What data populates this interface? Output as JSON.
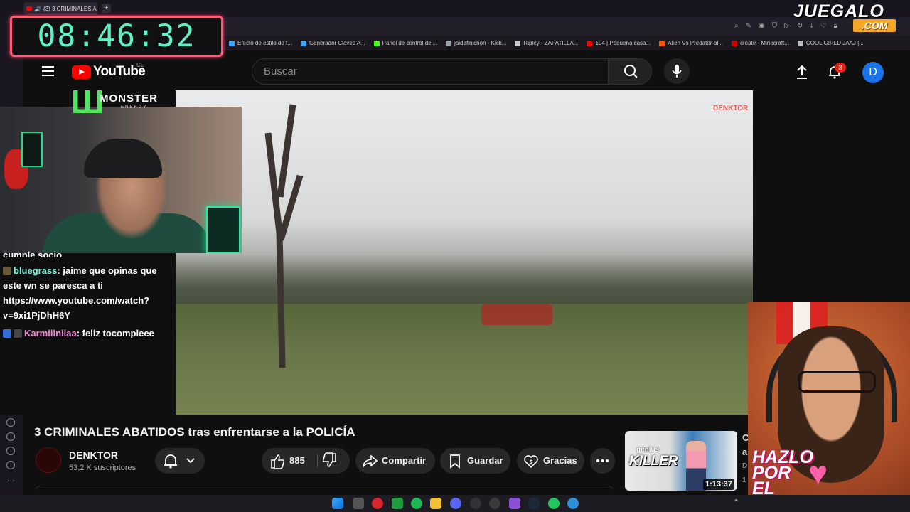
{
  "browser": {
    "tab_title": "(3) 3 CRIMINALES AB...",
    "new_tab": "+",
    "bookmarks": [
      {
        "label": "Efecto de estilo de t...",
        "color": "#3ea6ff"
      },
      {
        "label": "Generador Claves A...",
        "color": "#3ea6ff"
      },
      {
        "label": "Panel de control del...",
        "color": "#53fc18"
      },
      {
        "label": "jaidefinichon - Kick...",
        "color": "#9aa0a6"
      },
      {
        "label": "Ripley - ZAPATILLA...",
        "color": "#cccccc"
      },
      {
        "label": "194 | Pequeña casa...",
        "color": "#ff0000"
      },
      {
        "label": "Alien Vs Predator-al...",
        "color": "#ff5500"
      },
      {
        "label": "create - Minecraft...",
        "color": "#cc0000"
      },
      {
        "label": "COOL GIRLD JAAJ |...",
        "color": "#bbbbbb"
      }
    ]
  },
  "overlay": {
    "clock": "08:46:32",
    "brand_main": "JUEGALO",
    "brand_com": ".COM",
    "monster_logo": "MONSTER",
    "monster_sub": "ENERGY",
    "art_text_lines": [
      "HAZLO",
      "POR",
      "EL"
    ]
  },
  "youtube": {
    "logo_text": "YouTube",
    "country": "CL",
    "search_placeholder": "Buscar",
    "notifications_count": "3",
    "avatar_letter": "D",
    "watermark": "DENKTOR"
  },
  "chat": {
    "partial_line": "cumple socio",
    "messages": [
      {
        "user": "bluegrass",
        "text": ": jaime que opinas que este wn se paresca a ti https://www.youtube.com/watch?v=9xi1PjDhH6Y"
      },
      {
        "user": "Karmiiiniiaa",
        "text": ": feliz tocompleee"
      }
    ]
  },
  "video": {
    "title": "3 CRIMINALES ABATIDOS tras enfrentarse a la POLICÍA",
    "channel_name": "DENKTOR",
    "subscribers": "53,2 K suscriptores",
    "likes": "885",
    "share_label": "Compartir",
    "save_label": "Guardar",
    "thanks_label": "Gracias"
  },
  "recommended": {
    "thumb_top": "genius",
    "thumb_main": "KILLER",
    "duration": "1:13:37",
    "cut_text": "C\na\nD\n1"
  },
  "colors": {
    "yt_red": "#ff0000",
    "clock_digits": "#5df2c8",
    "clock_border": "#ff5c7a",
    "avatar_blue": "#1a73e8",
    "badge_red": "#e62117"
  }
}
